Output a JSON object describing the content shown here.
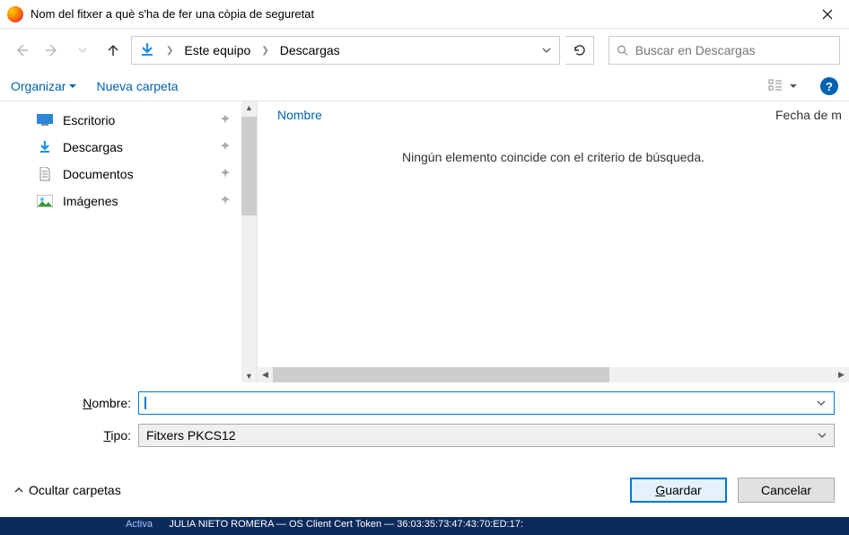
{
  "window": {
    "title": "Nom del fitxer a què s'ha de fer una còpia de seguretat"
  },
  "breadcrumb": {
    "items": [
      "Este equipo",
      "Descargas"
    ]
  },
  "search": {
    "placeholder": "Buscar en Descargas"
  },
  "toolbar": {
    "organize": "Organizar",
    "new_folder": "Nueva carpeta"
  },
  "sidebar": {
    "items": [
      {
        "label": "Escritorio",
        "icon": "desktop"
      },
      {
        "label": "Descargas",
        "icon": "download"
      },
      {
        "label": "Documentos",
        "icon": "document"
      },
      {
        "label": "Imágenes",
        "icon": "picture"
      }
    ]
  },
  "list": {
    "column_name": "Nombre",
    "column_date": "Fecha de m",
    "empty_message": "Ningún elemento coincide con el criterio de búsqueda."
  },
  "form": {
    "name_label_prefix": "N",
    "name_label_rest": "ombre:",
    "name_value": "",
    "type_label_prefix": "T",
    "type_label_rest": "ipo:",
    "type_value": "Fitxers PKCS12"
  },
  "footer": {
    "hide_folders": "Ocultar carpetas",
    "save_prefix": "G",
    "save_rest": "uardar",
    "cancel": "Cancelar"
  },
  "behind": {
    "text_left": "Activa",
    "text_right": "JULIA NIETO ROMERA — OS Client Cert Token — 36:03:35:73:47:43:70:ED:17:"
  }
}
